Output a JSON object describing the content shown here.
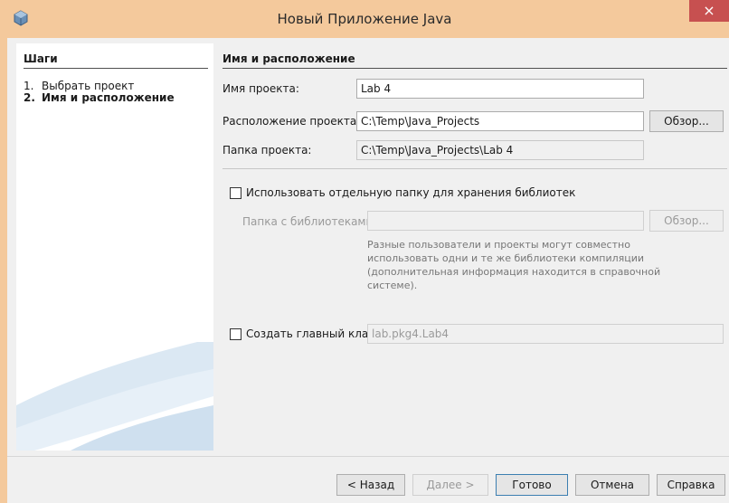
{
  "window": {
    "title": "Новый Приложение Java",
    "close_glyph": "×"
  },
  "steps": {
    "title": "Шаги",
    "items": [
      {
        "num": "1.",
        "label": "Выбрать проект",
        "current": false
      },
      {
        "num": "2.",
        "label": "Имя и расположение",
        "current": true
      }
    ]
  },
  "section": {
    "title": "Имя и расположение"
  },
  "form": {
    "project_name_label": "Имя проекта:",
    "project_name_value": "Lab 4",
    "location_label": "Расположение проекта:",
    "location_value": "C:\\Temp\\Java_Projects",
    "browse_label": "Обзор...",
    "folder_label": "Папка проекта:",
    "folder_value": "C:\\Temp\\Java_Projects\\Lab 4",
    "separate_libs_label": "Использовать отдельную папку для хранения библиотек",
    "libs_folder_label": "Папка с библиотеками:",
    "libs_folder_value": "",
    "libs_browse_label": "Обзор...",
    "libs_info": "Разные пользователи и проекты могут совместно использовать одни и те же библиотеки компиляции (дополнительная информация находится в справочной системе).",
    "main_class_label": "Создать главный класс",
    "main_class_value": "lab.pkg4.Lab4"
  },
  "footer": {
    "back_label": "< Назад",
    "next_label": "Далее >",
    "finish_label": "Готово",
    "cancel_label": "Отмена",
    "help_label": "Справка"
  },
  "colors": {
    "titlebar": "#f4c99c",
    "close_button": "#c75050",
    "panel": "#ffffff"
  }
}
